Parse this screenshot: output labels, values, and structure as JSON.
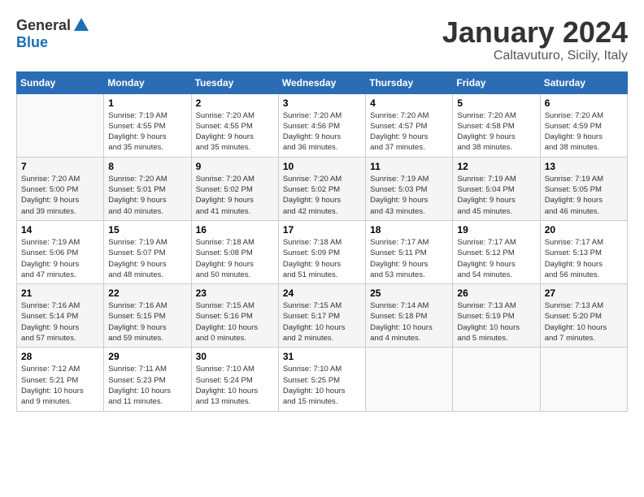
{
  "logo": {
    "general": "General",
    "blue": "Blue"
  },
  "title": "January 2024",
  "location": "Caltavuturo, Sicily, Italy",
  "days_header": [
    "Sunday",
    "Monday",
    "Tuesday",
    "Wednesday",
    "Thursday",
    "Friday",
    "Saturday"
  ],
  "weeks": [
    [
      {
        "day": "",
        "info": ""
      },
      {
        "day": "1",
        "info": "Sunrise: 7:19 AM\nSunset: 4:55 PM\nDaylight: 9 hours\nand 35 minutes."
      },
      {
        "day": "2",
        "info": "Sunrise: 7:20 AM\nSunset: 4:55 PM\nDaylight: 9 hours\nand 35 minutes."
      },
      {
        "day": "3",
        "info": "Sunrise: 7:20 AM\nSunset: 4:56 PM\nDaylight: 9 hours\nand 36 minutes."
      },
      {
        "day": "4",
        "info": "Sunrise: 7:20 AM\nSunset: 4:57 PM\nDaylight: 9 hours\nand 37 minutes."
      },
      {
        "day": "5",
        "info": "Sunrise: 7:20 AM\nSunset: 4:58 PM\nDaylight: 9 hours\nand 38 minutes."
      },
      {
        "day": "6",
        "info": "Sunrise: 7:20 AM\nSunset: 4:59 PM\nDaylight: 9 hours\nand 38 minutes."
      }
    ],
    [
      {
        "day": "7",
        "info": "Sunrise: 7:20 AM\nSunset: 5:00 PM\nDaylight: 9 hours\nand 39 minutes."
      },
      {
        "day": "8",
        "info": "Sunrise: 7:20 AM\nSunset: 5:01 PM\nDaylight: 9 hours\nand 40 minutes."
      },
      {
        "day": "9",
        "info": "Sunrise: 7:20 AM\nSunset: 5:02 PM\nDaylight: 9 hours\nand 41 minutes."
      },
      {
        "day": "10",
        "info": "Sunrise: 7:20 AM\nSunset: 5:02 PM\nDaylight: 9 hours\nand 42 minutes."
      },
      {
        "day": "11",
        "info": "Sunrise: 7:19 AM\nSunset: 5:03 PM\nDaylight: 9 hours\nand 43 minutes."
      },
      {
        "day": "12",
        "info": "Sunrise: 7:19 AM\nSunset: 5:04 PM\nDaylight: 9 hours\nand 45 minutes."
      },
      {
        "day": "13",
        "info": "Sunrise: 7:19 AM\nSunset: 5:05 PM\nDaylight: 9 hours\nand 46 minutes."
      }
    ],
    [
      {
        "day": "14",
        "info": "Sunrise: 7:19 AM\nSunset: 5:06 PM\nDaylight: 9 hours\nand 47 minutes."
      },
      {
        "day": "15",
        "info": "Sunrise: 7:19 AM\nSunset: 5:07 PM\nDaylight: 9 hours\nand 48 minutes."
      },
      {
        "day": "16",
        "info": "Sunrise: 7:18 AM\nSunset: 5:08 PM\nDaylight: 9 hours\nand 50 minutes."
      },
      {
        "day": "17",
        "info": "Sunrise: 7:18 AM\nSunset: 5:09 PM\nDaylight: 9 hours\nand 51 minutes."
      },
      {
        "day": "18",
        "info": "Sunrise: 7:17 AM\nSunset: 5:11 PM\nDaylight: 9 hours\nand 53 minutes."
      },
      {
        "day": "19",
        "info": "Sunrise: 7:17 AM\nSunset: 5:12 PM\nDaylight: 9 hours\nand 54 minutes."
      },
      {
        "day": "20",
        "info": "Sunrise: 7:17 AM\nSunset: 5:13 PM\nDaylight: 9 hours\nand 56 minutes."
      }
    ],
    [
      {
        "day": "21",
        "info": "Sunrise: 7:16 AM\nSunset: 5:14 PM\nDaylight: 9 hours\nand 57 minutes."
      },
      {
        "day": "22",
        "info": "Sunrise: 7:16 AM\nSunset: 5:15 PM\nDaylight: 9 hours\nand 59 minutes."
      },
      {
        "day": "23",
        "info": "Sunrise: 7:15 AM\nSunset: 5:16 PM\nDaylight: 10 hours\nand 0 minutes."
      },
      {
        "day": "24",
        "info": "Sunrise: 7:15 AM\nSunset: 5:17 PM\nDaylight: 10 hours\nand 2 minutes."
      },
      {
        "day": "25",
        "info": "Sunrise: 7:14 AM\nSunset: 5:18 PM\nDaylight: 10 hours\nand 4 minutes."
      },
      {
        "day": "26",
        "info": "Sunrise: 7:13 AM\nSunset: 5:19 PM\nDaylight: 10 hours\nand 5 minutes."
      },
      {
        "day": "27",
        "info": "Sunrise: 7:13 AM\nSunset: 5:20 PM\nDaylight: 10 hours\nand 7 minutes."
      }
    ],
    [
      {
        "day": "28",
        "info": "Sunrise: 7:12 AM\nSunset: 5:21 PM\nDaylight: 10 hours\nand 9 minutes."
      },
      {
        "day": "29",
        "info": "Sunrise: 7:11 AM\nSunset: 5:23 PM\nDaylight: 10 hours\nand 11 minutes."
      },
      {
        "day": "30",
        "info": "Sunrise: 7:10 AM\nSunset: 5:24 PM\nDaylight: 10 hours\nand 13 minutes."
      },
      {
        "day": "31",
        "info": "Sunrise: 7:10 AM\nSunset: 5:25 PM\nDaylight: 10 hours\nand 15 minutes."
      },
      {
        "day": "",
        "info": ""
      },
      {
        "day": "",
        "info": ""
      },
      {
        "day": "",
        "info": ""
      }
    ]
  ]
}
